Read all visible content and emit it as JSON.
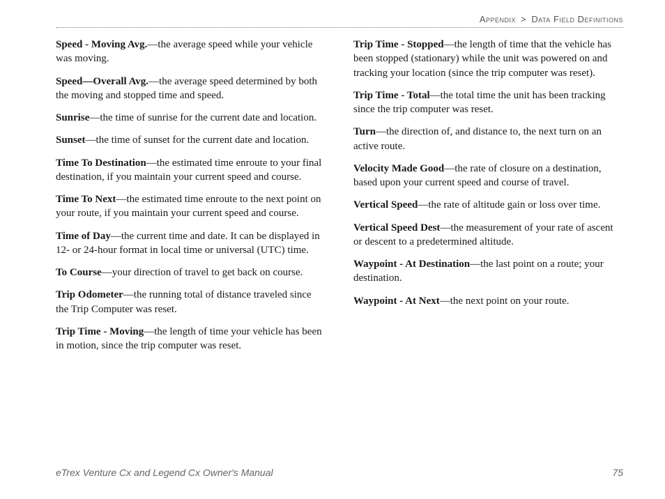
{
  "breadcrumb": {
    "section": "Appendix",
    "sep": ">",
    "page": "Data Field Definitions"
  },
  "left": [
    {
      "term": "Speed - Moving Avg.",
      "def": "—the average speed while your vehicle was moving."
    },
    {
      "term": "Speed—Overall Avg.",
      "def": "—the average speed determined by both the moving and stopped time and speed."
    },
    {
      "term": "Sunrise",
      "def": "—the time of sunrise for the current date and location."
    },
    {
      "term": "Sunset",
      "def": "—the time of sunset for the current date and location."
    },
    {
      "term": "Time To Destination",
      "def": "—the estimated time enroute to your final destination, if you maintain your current speed and course."
    },
    {
      "term": "Time To Next",
      "def": "—the estimated time enroute to the next point on your route, if you maintain your current speed and course."
    },
    {
      "term": "Time of Day",
      "def": "—the current time and date. It can be displayed in 12- or 24-hour format in local time or universal (UTC) time."
    },
    {
      "term": "To Course",
      "def": "—your direction of travel to get back on course."
    },
    {
      "term": "Trip Odometer",
      "def": "—the running total of distance traveled since the Trip Computer was reset."
    },
    {
      "term": "Trip Time - Moving",
      "def": "—the length of time your vehicle has been in motion, since the trip computer was reset."
    }
  ],
  "right": [
    {
      "term": "Trip Time - Stopped",
      "def": "—the length of time that the vehicle has been stopped (stationary) while the unit was powered on and tracking your location (since the trip computer was reset)."
    },
    {
      "term": "Trip Time - Total",
      "def": "—the total time the unit has been tracking since the trip computer was reset."
    },
    {
      "term": "Turn",
      "def": "—the direction of, and distance to, the next turn on an active route."
    },
    {
      "term": "Velocity Made Good",
      "def": "—the rate of closure on a destination, based upon your current speed and course of travel."
    },
    {
      "term": "Vertical Speed",
      "def": "—the rate of altitude gain or loss over time."
    },
    {
      "term": "Vertical Speed Dest",
      "def": "—the measurement of your rate of ascent or descent to a predetermined altitude."
    },
    {
      "term": "Waypoint -  At Destination",
      "def": "—the last point on a route; your destination."
    },
    {
      "term": "Waypoint - At Next",
      "def": "—the next point on your route."
    }
  ],
  "footer": {
    "title": "eTrex Venture Cx and Legend Cx Owner's Manual",
    "page": "75"
  }
}
